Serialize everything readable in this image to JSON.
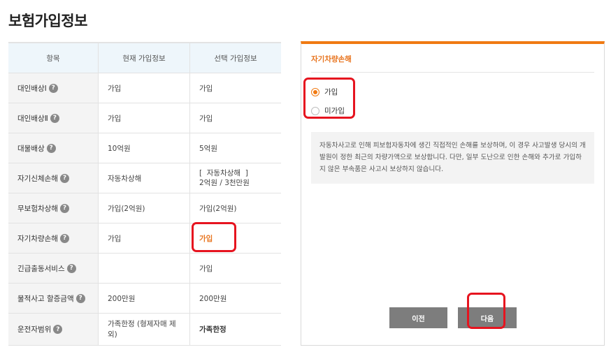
{
  "page": {
    "title": "보험가입정보"
  },
  "table": {
    "headers": [
      "항목",
      "현재 가입정보",
      "선택 가입정보"
    ],
    "rows": [
      {
        "item": "대인배상Ⅰ",
        "current": "가입",
        "selected": "가입"
      },
      {
        "item": "대인배상Ⅱ",
        "current": "가입",
        "selected": "가입"
      },
      {
        "item": "대물배상",
        "current": "10억원",
        "selected": "5억원"
      },
      {
        "item": "자기신체손해",
        "current": "자동차상해",
        "selected_line1": "[  자동차상해  ]",
        "selected_line2": "2억원 / 3천만원"
      },
      {
        "item": "무보험차상해",
        "current": "가입(2억원)",
        "selected": "가입(2억원)"
      },
      {
        "item": "자기차량손해",
        "current": "가입",
        "selected": "가입"
      },
      {
        "item": "긴급출동서비스",
        "current": "",
        "selected": "가입"
      },
      {
        "item": "물적사고 할증금액",
        "current": "200만원",
        "selected": "200만원"
      },
      {
        "item": "운전자범위",
        "current": "가족한정 (형제자매 제외)",
        "selected": "가족한정"
      }
    ],
    "help_glyph": "?"
  },
  "panel": {
    "title": "자기차량손해",
    "options": [
      {
        "label": "가입",
        "checked": true
      },
      {
        "label": "미가입",
        "checked": false
      }
    ],
    "description": "자동차사고로 인해 피보험자동차에 생긴 직접적인 손해를 보상하며, 이 경우 사고발생 당시의 개발원이 정한 최근의 차량가액으로 보상합니다. 다만, 일부 도난으로 인한 손해와 추가로 가입하지 않은 부속품은 사고시 보상하지 않습니다.",
    "prev_label": "이전",
    "next_label": "다음"
  },
  "colors": {
    "accent": "#f07a12",
    "highlight": "#e6141f",
    "button": "#7d7d7d"
  }
}
